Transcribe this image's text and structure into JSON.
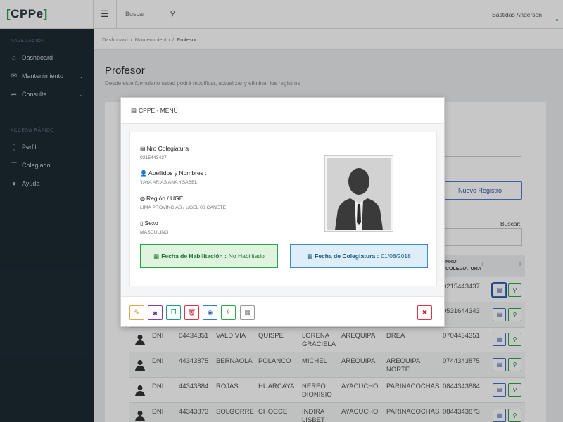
{
  "brand": {
    "open": "[",
    "name": "CPPe",
    "close": "]"
  },
  "sidebar": {
    "nav_section": "NAVEGACIÓN",
    "nav_items": [
      {
        "label": "Dashboard",
        "icon": "dashboard-icon"
      },
      {
        "label": "Mantenimiento",
        "icon": "mail-icon"
      },
      {
        "label": "Consulta",
        "icon": "share-icon"
      }
    ],
    "quick_section": "ACCESO RÁPIDO",
    "quick_items": [
      {
        "label": "Perfil",
        "icon": "book-icon"
      },
      {
        "label": "Colegiado",
        "icon": "list-icon"
      },
      {
        "label": "Ayuda",
        "icon": "globe-icon"
      }
    ]
  },
  "topbar": {
    "search_placeholder": "Buscar",
    "user_name": "Bastidas Anderson"
  },
  "breadcrumb": [
    "Dashboard",
    "Mantenimiento",
    "Profesor"
  ],
  "page": {
    "title": "Profesor",
    "subtitle": "Desde este formulario usted podrá modificar, actualizar y eliminar los registros."
  },
  "main": {
    "nuevo_registro_label": "Nuevo Registro",
    "buscar_label": "Buscar:",
    "table_header_nro_line1": "NRO",
    "table_header_nro_line2": "COLEGIATURA",
    "rows": [
      {
        "doc": "",
        "num": "",
        "ap1": "",
        "ap2": "",
        "nombres": [
          "",
          ""
        ],
        "region": "",
        "ugel": "",
        "nro": "0215443437"
      },
      {
        "doc": "",
        "num": "",
        "ap1": "",
        "ap2": "",
        "nombres": [
          "",
          ""
        ],
        "region": "",
        "ugel": "",
        "nro": "0531644343"
      },
      {
        "doc": "DNI",
        "num": "04434351",
        "ap1": "VALDIVIA",
        "ap2": "QUISPE",
        "nombres": [
          "LORENA",
          "GRACIELA"
        ],
        "region": "AREQUIPA",
        "ugel": "DREA",
        "nro": "0704434351"
      },
      {
        "doc": "DNI",
        "num": "44343875",
        "ap1": "BERNAOLA",
        "ap2": "POLANCO",
        "nombres": [
          "MICHEL",
          ""
        ],
        "region": "AREQUIPA",
        "ugel": "AREQUIPA NORTE",
        "nro": "0744343875"
      },
      {
        "doc": "DNI",
        "num": "44343884",
        "ap1": "ROJAS",
        "ap2": "HUARCAYA",
        "nombres": [
          "NEREO",
          "DIONISIO"
        ],
        "region": "AYACUCHO",
        "ugel": "PARINACOCHAS",
        "nro": "0844343884"
      },
      {
        "doc": "DNI",
        "num": "44343873",
        "ap1": "SOLGORRE",
        "ap2": "CHOCCE",
        "nombres": [
          "INDIRA",
          "LISBET"
        ],
        "region": "AYACUCHO",
        "ugel": "PARINACOCHAS",
        "nro": "0844343873"
      }
    ]
  },
  "modal": {
    "title": "CPPE - MENÚ",
    "fields": [
      {
        "label": "Nro Colegiatura :",
        "value": "0215443437",
        "icon": "id-card-icon"
      },
      {
        "label": "Apellidos y Nombres :",
        "value": "YAYA ARIAS ANA YSABEL",
        "icon": "user-icon"
      },
      {
        "label": "Región / UGEL :",
        "value": "LIMA PROVINCIAS / UGEL 08 CAÑETE",
        "icon": "globe-icon"
      },
      {
        "label": "Sexo",
        "value": "MASCULINO",
        "icon": "mobile-icon"
      }
    ],
    "habilitacion": {
      "label": "Fecha de Habilitación :",
      "value": "No Habilitado"
    },
    "colegiatura": {
      "label": "Fecha de Colegiatura :",
      "value": "01/08/2018"
    }
  },
  "colors": {
    "sidebar_bg": "#1c2a33",
    "accent_green": "#28a745",
    "accent_blue": "#3b6fd0",
    "danger": "#dc3545"
  }
}
